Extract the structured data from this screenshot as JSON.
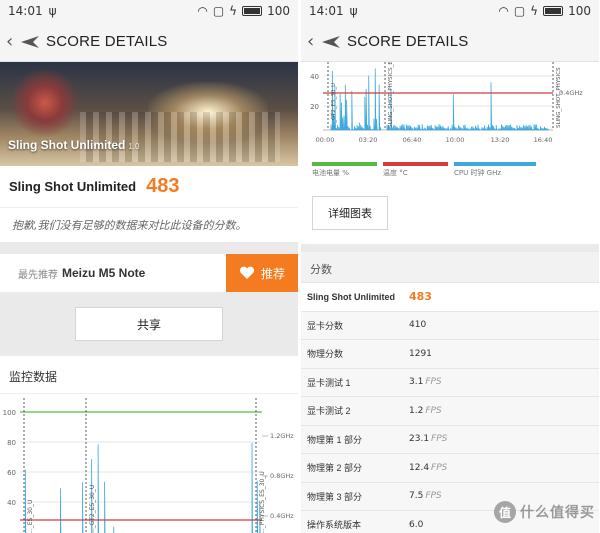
{
  "status": {
    "time": "14:01",
    "battery": "100"
  },
  "titlebar": {
    "title": "SCORE DETAILS"
  },
  "left": {
    "hero": {
      "title": "Sling Shot Unlimited",
      "version": "1.0"
    },
    "score": {
      "name": "Sling Shot Unlimited",
      "value": "483"
    },
    "note": "抱歉,我们没有足够的数据来对比此设备的分数。",
    "recommend": {
      "label": "最先推荐",
      "device": "Meizu M5 Note",
      "button": "推荐"
    },
    "share_button": "共享",
    "monitor_title": "监控数据",
    "chart": {
      "y_ticks": [
        "100",
        "80",
        "60",
        "40"
      ],
      "right_ticks": [
        "1.2GHz",
        "0.8GHz",
        "0.4GHz"
      ],
      "phase_labels": [
        "..._ES_30_U",
        "..._GT2_ES_30_U",
        "..._PHYSICS_ES_30_U"
      ]
    }
  },
  "right": {
    "chart": {
      "y_ticks": [
        "40",
        "20"
      ],
      "x_ticks": [
        "00:00",
        "03:20",
        "06:40",
        "10:00",
        "13:20",
        "16:40"
      ],
      "right_tick": "0.4GHz",
      "phase_labels": [
        "..._GT2_ES_30_U",
        "SLING_SHOT_PHYSICS_ES_30_U",
        "SLING_SHOT_PHYSICS"
      ]
    },
    "legend": [
      {
        "label": "电池电量 %",
        "color": "#5ab946"
      },
      {
        "label": "温度 °C",
        "color": "#d23c3c"
      },
      {
        "label": "CPU 时钟 GHz",
        "color": "#3fa9dc"
      }
    ],
    "detail_button": "详细图表",
    "section_title": "分数",
    "table": [
      {
        "label": "Sling Shot Unlimited",
        "value": "483",
        "unit": ""
      },
      {
        "label": "显卡分数",
        "value": "410",
        "unit": ""
      },
      {
        "label": "物理分数",
        "value": "1291",
        "unit": ""
      },
      {
        "label": "显卡测试 1",
        "value": "3.1",
        "unit": "FPS"
      },
      {
        "label": "显卡测试 2",
        "value": "1.2",
        "unit": "FPS"
      },
      {
        "label": "物理第 1 部分",
        "value": "23.1",
        "unit": "FPS"
      },
      {
        "label": "物理第 2 部分",
        "value": "12.4",
        "unit": "FPS"
      },
      {
        "label": "物理第 3 部分",
        "value": "7.5",
        "unit": "FPS"
      },
      {
        "label": "操作系统版本",
        "value": "6.0",
        "unit": ""
      }
    ]
  },
  "watermark": {
    "badge": "值",
    "text": "什么值得买"
  }
}
